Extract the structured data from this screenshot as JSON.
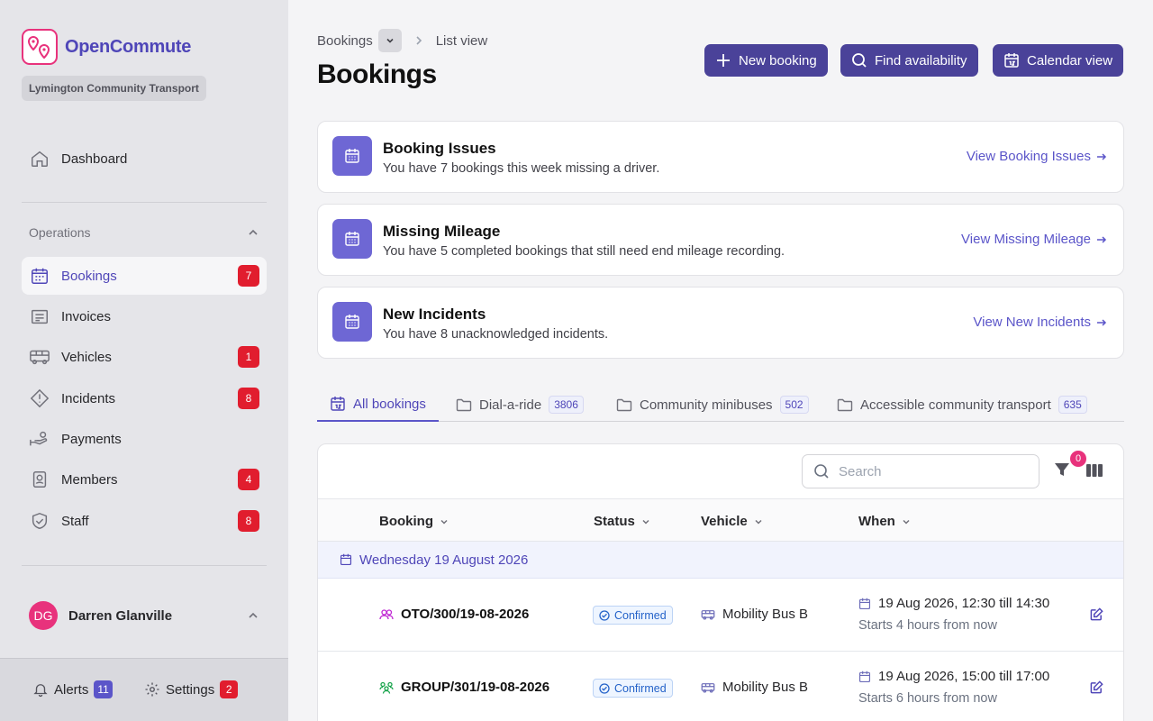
{
  "app": {
    "name": "OpenCommute",
    "organisation": "Lymington Community Transport",
    "brand_color": "#4f46b8",
    "accent_color": "#e8327c"
  },
  "sidebar": {
    "dashboard_label": "Dashboard",
    "section_label": "Operations",
    "items": [
      {
        "label": "Bookings",
        "icon": "calendar-icon",
        "count": "7"
      },
      {
        "label": "Invoices",
        "icon": "receipt-icon",
        "count": ""
      },
      {
        "label": "Vehicles",
        "icon": "bus-icon",
        "count": "1"
      },
      {
        "label": "Incidents",
        "icon": "warning-icon",
        "count": "8"
      },
      {
        "label": "Payments",
        "icon": "hand-coins-icon",
        "count": ""
      },
      {
        "label": "Members",
        "icon": "id-badge-icon",
        "count": "4"
      },
      {
        "label": "Staff",
        "icon": "shield-icon",
        "count": "8"
      }
    ],
    "user": {
      "initials": "DG",
      "name": "Darren Glanville"
    },
    "alerts_label": "Alerts",
    "alerts_count": "11",
    "settings_label": "Settings",
    "settings_count": "2"
  },
  "header": {
    "breadcrumb_root": "Bookings",
    "breadcrumb_current": "List view",
    "title": "Bookings",
    "buttons": {
      "new_booking": "New booking",
      "find_availability": "Find availability",
      "calendar_view": "Calendar view"
    }
  },
  "alerts": [
    {
      "title": "Booking Issues",
      "description": "You have 7 bookings this week missing a driver.",
      "link": "View Booking Issues"
    },
    {
      "title": "Missing Mileage",
      "description": "You have 5 completed bookings that still need end mileage recording.",
      "link": "View Missing Mileage"
    },
    {
      "title": "New Incidents",
      "description": "You have 8 unacknowledged incidents.",
      "link": "View New Incidents"
    }
  ],
  "tabs": [
    {
      "label": "All bookings",
      "count": ""
    },
    {
      "label": "Dial-a-ride",
      "count": "3806"
    },
    {
      "label": "Community minibuses",
      "count": "502"
    },
    {
      "label": "Accessible community transport",
      "count": "635"
    }
  ],
  "table": {
    "search_placeholder": "Search",
    "filter_count": "0",
    "columns": {
      "booking": "Booking",
      "status": "Status",
      "vehicle": "Vehicle",
      "when": "When"
    },
    "group_label": "Wednesday 19 August 2026",
    "rows": [
      {
        "ref": "OTO/300/19-08-2026",
        "ref_icon": "users-icon",
        "status": "Confirmed",
        "vehicle": "Mobility Bus B",
        "when": "19 Aug 2026, 12:30 till 14:30",
        "relative": "Starts 4 hours from now"
      },
      {
        "ref": "GROUP/301/19-08-2026",
        "ref_icon": "group-icon",
        "status": "Confirmed",
        "vehicle": "Mobility Bus B",
        "when": "19 Aug 2026, 15:00 till 17:00",
        "relative": "Starts 6 hours from now"
      }
    ]
  }
}
